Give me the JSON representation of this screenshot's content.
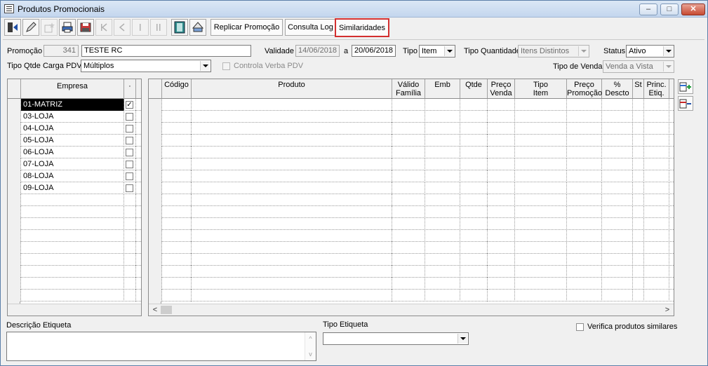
{
  "window": {
    "title": "Produtos Promocionais",
    "min": "–",
    "max": "□",
    "close": "✕"
  },
  "toolbar": {
    "icons": [
      "exit-icon",
      "pencil-icon",
      "new-item-icon",
      "print-icon",
      "save-icon",
      "first-icon",
      "prev-icon",
      "next-icon",
      "last-icon",
      "film-icon",
      "preview-icon"
    ],
    "replicar": "Replicar Promoção",
    "consulta_log": "Consulta Log",
    "similaridades": "Similaridades"
  },
  "form": {
    "promocao_label": "Promoção",
    "promocao_value": "341",
    "descricao_value": "TESTE RC",
    "validade_label": "Validade",
    "validade_de": "14/06/2018",
    "validade_a_label": "a",
    "validade_ate": "20/06/2018",
    "tipo_label": "Tipo",
    "tipo_value": "Item",
    "tipo_quantidade_label": "Tipo Quantidade",
    "tipo_quantidade_value": "Itens Distintos",
    "status_label": "Status",
    "status_value": "Ativo",
    "tipo_qtde_carga_label": "Tipo Qtde Carga PDV",
    "tipo_qtde_carga_value": "Múltiplos",
    "controla_verba_label": "Controla Verba PDV",
    "tipo_venda_label": "Tipo de Venda",
    "tipo_venda_value": "Venda a Vista"
  },
  "empresas": {
    "header_empresa": "Empresa",
    "header_check": "·",
    "rows": [
      {
        "name": "01-MATRIZ",
        "checked": true
      },
      {
        "name": "03-LOJA",
        "checked": false
      },
      {
        "name": "04-LOJA",
        "checked": false
      },
      {
        "name": "05-LOJA",
        "checked": false
      },
      {
        "name": "06-LOJA",
        "checked": false
      },
      {
        "name": "07-LOJA",
        "checked": false
      },
      {
        "name": "08-LOJA",
        "checked": false
      },
      {
        "name": "09-LOJA",
        "checked": false
      }
    ]
  },
  "produtos": {
    "columns": [
      {
        "label": "Código"
      },
      {
        "label": "Produto"
      },
      {
        "label": "Válido\nFamília"
      },
      {
        "label": "Emb"
      },
      {
        "label": "Qtde"
      },
      {
        "label": "Preço\nVenda"
      },
      {
        "label": "Tipo\nItem"
      },
      {
        "label": "Preço\nPromoção"
      },
      {
        "label": "%\nDescto"
      },
      {
        "label": "St"
      },
      {
        "label": "Princ.\nEtiq."
      }
    ],
    "scroll_left": "<",
    "scroll_right": ">"
  },
  "bottom": {
    "descricao_etiqueta_label": "Descrição Etiqueta",
    "tipo_etiqueta_label": "Tipo Etiqueta",
    "tipo_etiqueta_value": "",
    "verifica_label": "Verifica produtos similares",
    "memo_up": "^",
    "memo_down": "v"
  },
  "colors": {
    "selection_highlight": "#d32f2f",
    "selected_row": "#000000"
  }
}
